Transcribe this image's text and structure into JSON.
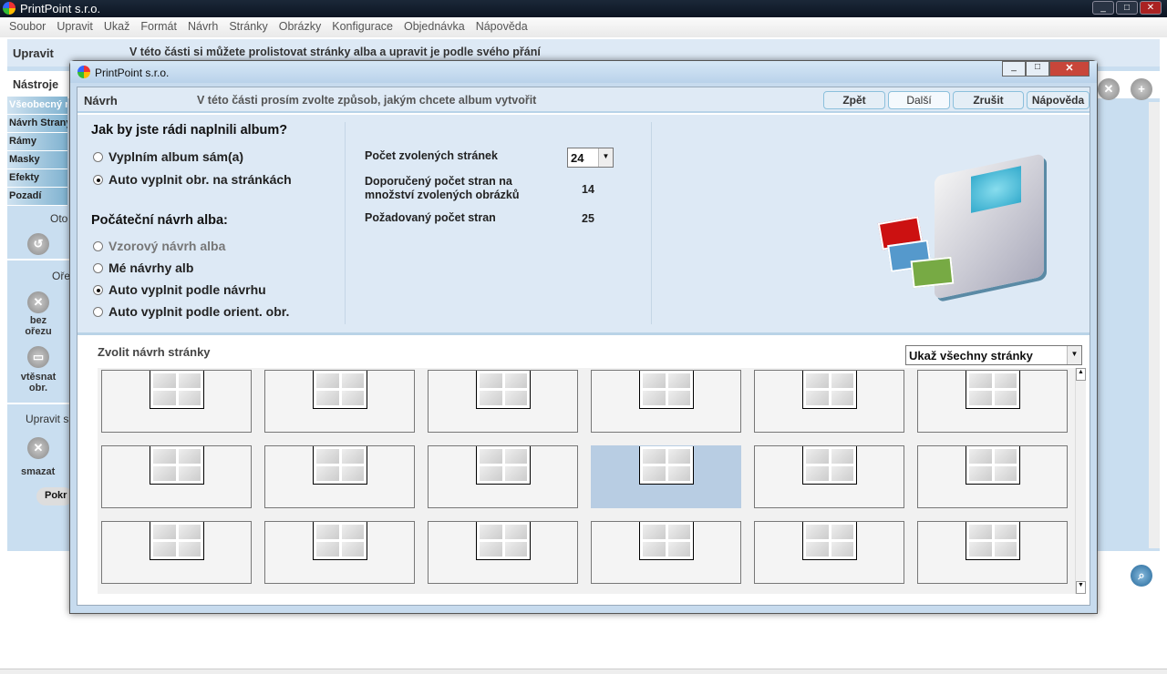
{
  "app": {
    "title": "PrintPoint s.r.o.",
    "menu": [
      "Soubor",
      "Upravit",
      "Ukaž",
      "Formát",
      "Návrh",
      "Stránky",
      "Obrázky",
      "Konfigurace",
      "Objednávka",
      "Nápověda"
    ],
    "header_title": "Upravit",
    "header_text": "V této části si můžete prolistovat stránky alba a upravit je podle svého přání",
    "tools_label": "Nástroje",
    "side_tabs": [
      "Všeobecný r",
      "Návrh Strany",
      "Rámy",
      "Masky",
      "Efekty",
      "Pozadí"
    ],
    "rotate_label": "Oto",
    "crop_label": "Oře",
    "no_crop": "bez ořezu",
    "fit_image": "vtěsnat obr.",
    "edit_label": "Upravit s",
    "delete_label": "smazat",
    "advanced_btn": "Pokr"
  },
  "dialog": {
    "title": "PrintPoint s.r.o.",
    "section": "Návrh",
    "instruction": "V této části prosím zvolte způsob, jakým chcete album vytvořit",
    "buttons": {
      "back": "Zpět",
      "next": "Další",
      "cancel": "Zrušit",
      "help": "Nápověda"
    },
    "fill_question": "Jak by jste rádi naplnili album?",
    "fill_options": [
      {
        "label": "Vyplním album sám(a)",
        "checked": false
      },
      {
        "label": "Auto vyplnit obr. na stránkách",
        "checked": true
      }
    ],
    "design_question": "Počáteční návrh alba:",
    "design_options": [
      {
        "label": "Vzorový návrh alba",
        "checked": false,
        "disabled": true
      },
      {
        "label": "Mé návrhy alb",
        "checked": false
      },
      {
        "label": "Auto vyplnit podle návrhu",
        "checked": true
      },
      {
        "label": "Auto vyplnit podle orient. obr.",
        "checked": false
      }
    ],
    "pages_label": "Počet zvolených stránek",
    "pages_value": "24",
    "recommended_label": "Doporučený  počet stran na množství zvolených obrázků",
    "recommended_value": "14",
    "required_label": "Požadovaný počet stran",
    "required_value": "25",
    "page_design_label": "Zvolit návrh stránky",
    "filter_value": "Ukaž všechny stránky",
    "selected_layout_index": 9,
    "layout_count": 18
  }
}
